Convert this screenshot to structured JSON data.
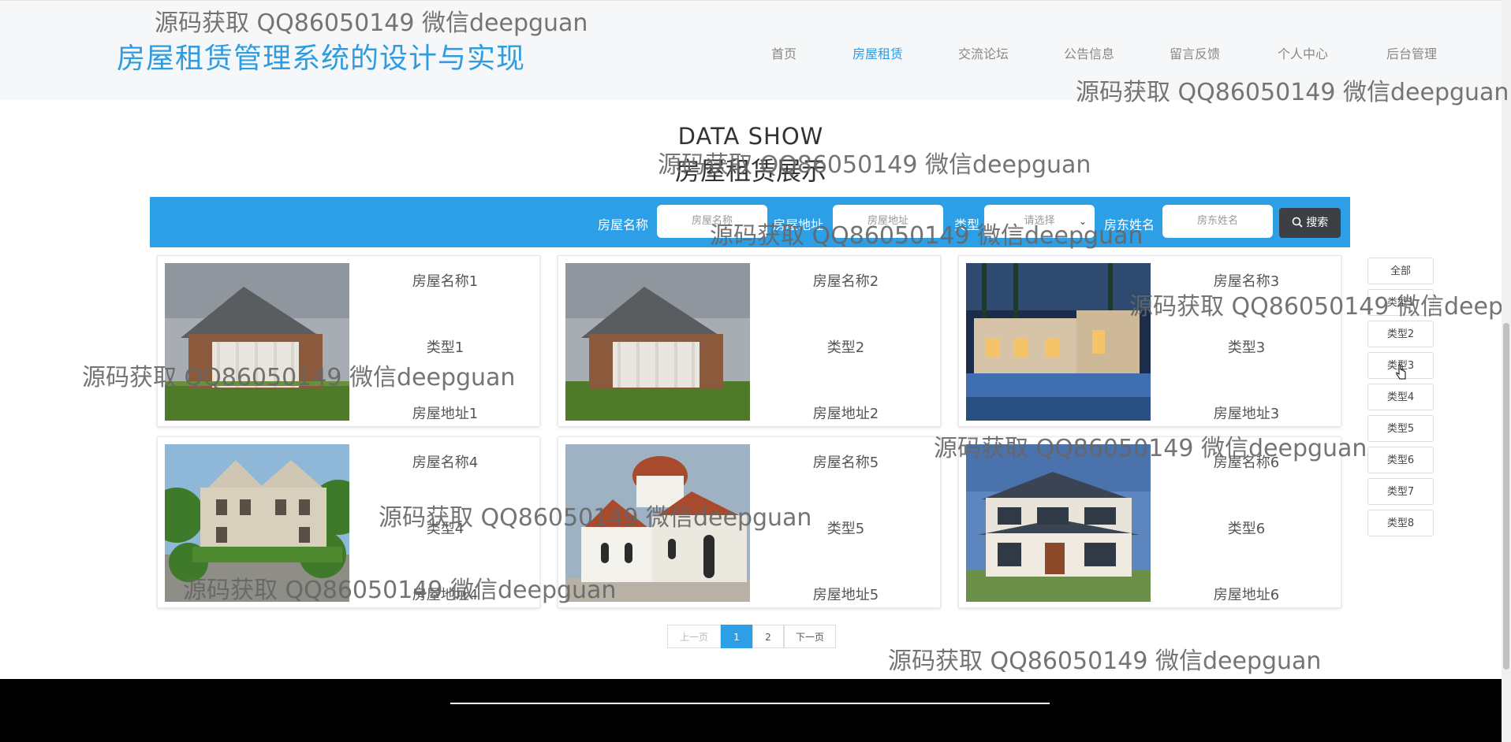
{
  "header": {
    "site_title": "房屋租赁管理系统的设计与实现",
    "nav": [
      "首页",
      "房屋租赁",
      "交流论坛",
      "公告信息",
      "留言反馈",
      "个人中心",
      "后台管理"
    ],
    "active_index": 1
  },
  "section": {
    "title_en": "DATA SHOW",
    "title_zh": "房屋租赁展示"
  },
  "search": {
    "name_label": "房屋名称",
    "name_placeholder": "房屋名称",
    "address_label": "房屋地址",
    "address_placeholder": "房屋地址",
    "type_label": "类型",
    "type_value": "请选择",
    "landlord_label": "房东姓名",
    "landlord_placeholder": "房东姓名",
    "button_label": "搜索"
  },
  "cards": [
    {
      "name": "房屋名称1",
      "type": "类型1",
      "address": "房屋地址1",
      "image": "brick-colonial-house"
    },
    {
      "name": "房屋名称2",
      "type": "类型2",
      "address": "房屋地址2",
      "image": "brick-colonial-house"
    },
    {
      "name": "房屋名称3",
      "type": "类型3",
      "address": "房屋地址3",
      "image": "villa-night-pool"
    },
    {
      "name": "房屋名称4",
      "type": "类型4",
      "address": "房屋地址4",
      "image": "stone-manor-garden"
    },
    {
      "name": "房屋名称5",
      "type": "类型5",
      "address": "房屋地址5",
      "image": "white-chapel"
    },
    {
      "name": "房屋名称6",
      "type": "类型6",
      "address": "房屋地址6",
      "image": "modern-two-story-villa"
    }
  ],
  "categories": [
    "全部",
    "类型1",
    "类型2",
    "类型3",
    "类型4",
    "类型5",
    "类型6",
    "类型7",
    "类型8"
  ],
  "pagination": {
    "prev": "上一页",
    "pages": [
      "1",
      "2"
    ],
    "current": "1",
    "next": "下一页"
  },
  "watermark": "源码获取 QQ86050149 微信deepguan",
  "colors": {
    "accent": "#2f9ce0",
    "search_bar": "#2d9fe6",
    "search_button": "#3c3f44",
    "footer": "#000000"
  }
}
